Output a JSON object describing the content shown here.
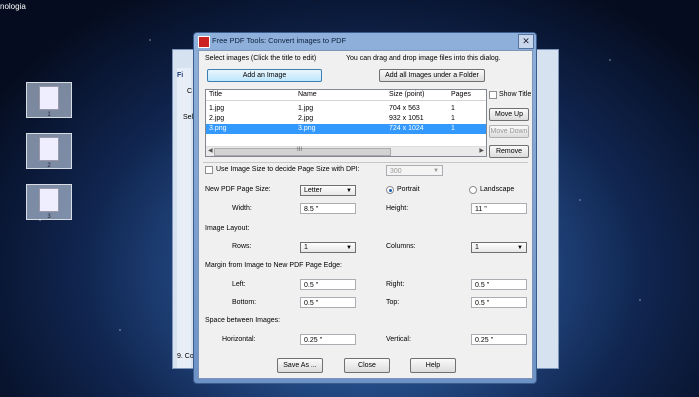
{
  "desktop": {
    "corner_text": "nologia",
    "icons": [
      {
        "label": "1"
      },
      {
        "label": "2"
      },
      {
        "label": "3"
      }
    ]
  },
  "background_window": {
    "tab_fi": "Fi",
    "item_c": "C",
    "sel_text": "Sel",
    "status": "9. Co"
  },
  "dialog": {
    "title": "Free PDF Tools: Convert images to PDF",
    "close_glyph": "✕",
    "select_images_label": "Select images (Click the title to edit)",
    "drag_hint": "You can drag and drop image files into this dialog.",
    "add_image_label": "Add an Image",
    "add_folder_label": "Add all Images under a Folder",
    "show_title_label": "Show Title",
    "move_up_label": "Move Up",
    "move_down_label": "Move Down",
    "remove_label": "Remove",
    "columns": [
      "Title",
      "Name",
      "Size (point)",
      "Pages"
    ],
    "rows": [
      {
        "title": "1.jpg",
        "name": "1.jpg",
        "size": "704 x 563",
        "pages": "1",
        "selected": false
      },
      {
        "title": "2.jpg",
        "name": "2.jpg",
        "size": "932 x 1051",
        "pages": "1",
        "selected": false
      },
      {
        "title": "3.png",
        "name": "3.png",
        "size": "724 x 1024",
        "pages": "1",
        "selected": true
      }
    ],
    "scroll_mark": "III",
    "use_image_size_label": "Use Image Size to decide Page Size with DPI:",
    "dpi_value": "300",
    "page_size_label": "New PDF Page Size:",
    "page_size_value": "Letter",
    "portrait_label": "Portrait",
    "landscape_label": "Landscape",
    "width_label": "Width:",
    "width_value": "8.5 ''",
    "height_label": "Height:",
    "height_value": "11 ''",
    "image_layout_label": "Image Layout:",
    "rows_label": "Rows:",
    "rows_value": "1",
    "columns_label": "Columns:",
    "columns_value": "1",
    "margin_label": "Margin from Image to New PDF Page Edge:",
    "left_label": "Left:",
    "left_value": "0.5 ''",
    "right_label": "Right:",
    "right_value": "0.5 ''",
    "bottom_label": "Bottom:",
    "bottom_value": "0.5 ''",
    "top_label": "Top:",
    "top_value": "0.5 ''",
    "spacing_label": "Space between Images:",
    "horizontal_label": "Horizontal:",
    "horizontal_value": "0.25 ''",
    "vertical_label": "Vertical:",
    "vertical_value": "0.25 ''",
    "save_label": "Save As ...",
    "close_label": "Close",
    "help_label": "Help"
  }
}
